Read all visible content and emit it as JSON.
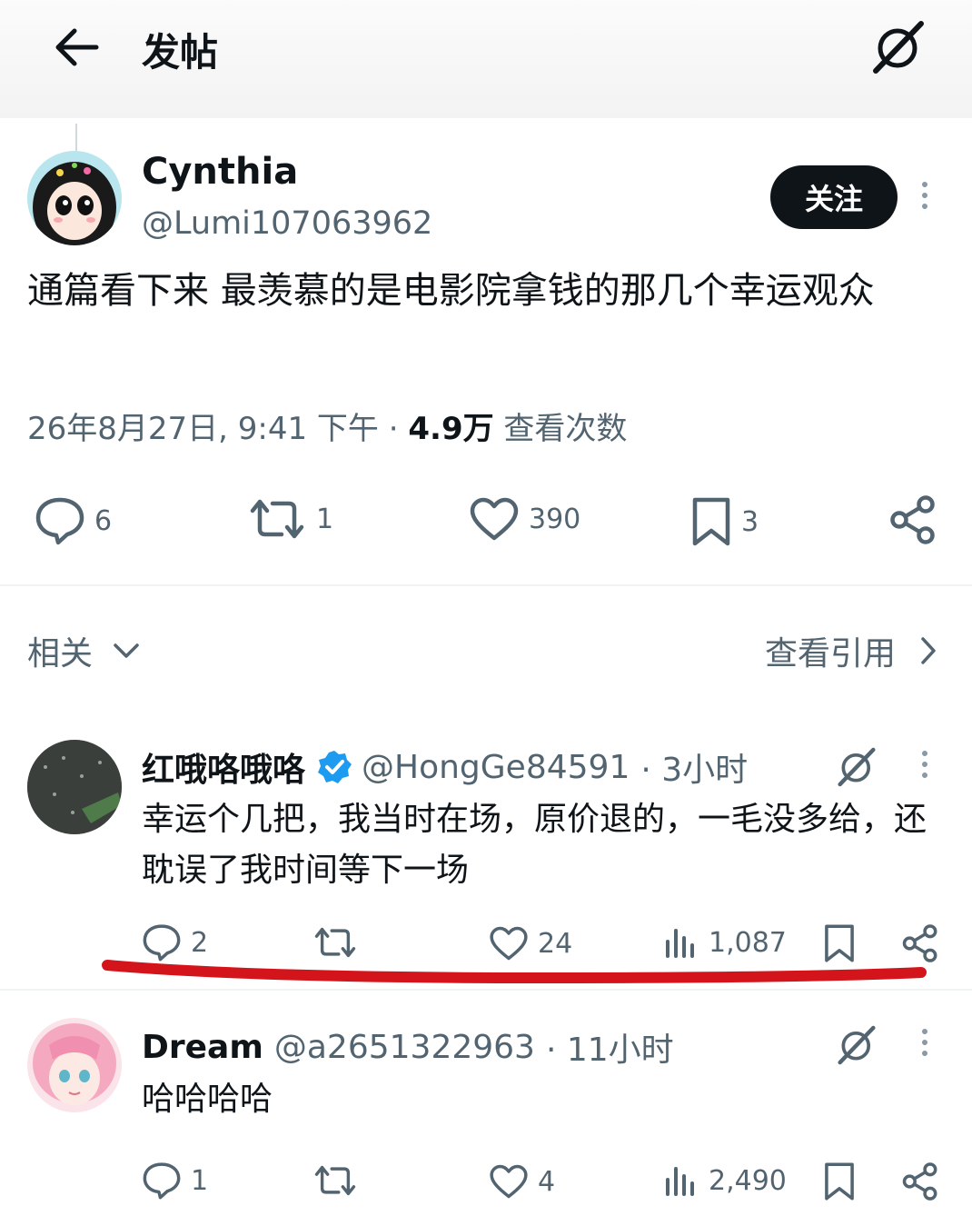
{
  "header": {
    "title": "发帖",
    "back_icon": "arrow-left-icon",
    "grok_icon": "grok-icon"
  },
  "post": {
    "author_name": "Cynthia",
    "author_handle": "@Lumi107063962",
    "follow_label": "关注",
    "text": "通篇看下来 最羡慕的是电影院拿钱的那几个幸运观众",
    "date": "26年8月27日, 9:41 下午",
    "separator": "·",
    "views_count": "4.9万",
    "views_label": "查看次数",
    "stats": {
      "replies": "6",
      "reposts": "1",
      "likes": "390",
      "bookmarks": "3"
    }
  },
  "related": {
    "label": "相关",
    "quotes_label": "查看引用"
  },
  "replies": [
    {
      "name": "红哦咯哦咯",
      "handle": "@HongGe84591",
      "time": "· 3小时",
      "verified": true,
      "text": "幸运个几把，我当时在场，原价退的，一毛没多给，还耽误了我时间等下一场",
      "stats": {
        "replies": "2",
        "reposts": "",
        "likes": "24",
        "views": "1,087"
      }
    },
    {
      "name": "Dream",
      "handle": "@a2651322963",
      "time": "· 11小时",
      "verified": false,
      "text": "哈哈哈哈",
      "stats": {
        "replies": "1",
        "reposts": "",
        "likes": "4",
        "views": "2,490"
      }
    }
  ],
  "colors": {
    "text": "#0f1419",
    "muted": "#536471",
    "verified": "#1d9bf0",
    "annotation": "#d4141b",
    "button": "#0f1419"
  }
}
